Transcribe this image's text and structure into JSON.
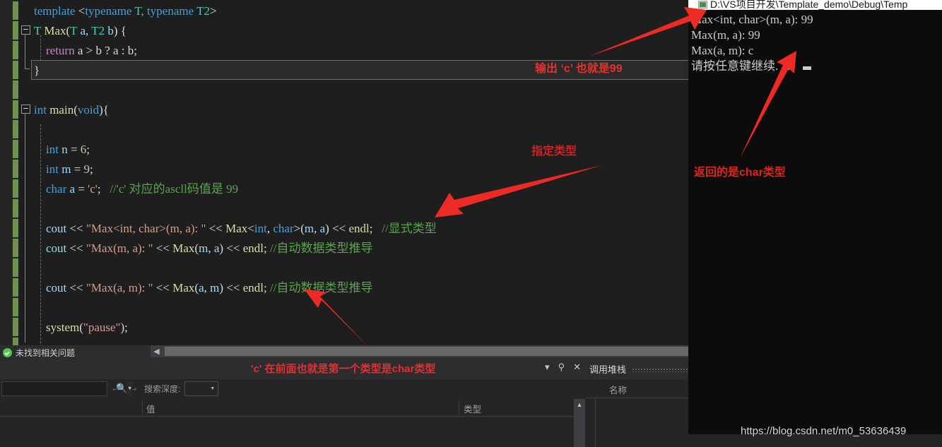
{
  "editor": {
    "lines": [
      {
        "indent": 0,
        "tokens": [
          {
            "t": "template ",
            "c": "k"
          },
          {
            "t": "<",
            "c": "op"
          },
          {
            "t": "typename",
            "c": "k"
          },
          {
            "t": " T, ",
            "c": "type"
          },
          {
            "t": "typename",
            "c": "k"
          },
          {
            "t": " T2",
            "c": "type"
          },
          {
            "t": ">",
            "c": "op"
          }
        ]
      },
      {
        "indent": 0,
        "tokens": [
          {
            "t": "T",
            "c": "type"
          },
          {
            "t": " ",
            "c": "op"
          },
          {
            "t": "Max",
            "c": "fn"
          },
          {
            "t": "(",
            "c": "pn"
          },
          {
            "t": "T",
            "c": "type"
          },
          {
            "t": " a, ",
            "c": "id"
          },
          {
            "t": "T2",
            "c": "type"
          },
          {
            "t": " b",
            "c": "id"
          },
          {
            "t": ") {",
            "c": "pn"
          }
        ]
      },
      {
        "indent": 0,
        "tokens": [
          {
            "t": "    ",
            "c": "op"
          },
          {
            "t": "return",
            "c": "pl"
          },
          {
            "t": " a > b ? a : b;",
            "c": "op"
          }
        ]
      },
      {
        "indent": 0,
        "tokens": [
          {
            "t": "}",
            "c": "pn"
          }
        ]
      },
      {
        "indent": 0,
        "tokens": []
      },
      {
        "indent": 0,
        "tokens": [
          {
            "t": "int",
            "c": "k"
          },
          {
            "t": " ",
            "c": "op"
          },
          {
            "t": "main",
            "c": "fn"
          },
          {
            "t": "(",
            "c": "pn"
          },
          {
            "t": "void",
            "c": "k"
          },
          {
            "t": "){",
            "c": "pn"
          }
        ]
      },
      {
        "indent": 0,
        "tokens": []
      },
      {
        "indent": 0,
        "tokens": [
          {
            "t": "    ",
            "c": "op"
          },
          {
            "t": "int",
            "c": "k"
          },
          {
            "t": " ",
            "c": "op"
          },
          {
            "t": "n",
            "c": "id"
          },
          {
            "t": " = ",
            "c": "op"
          },
          {
            "t": "6",
            "c": "num"
          },
          {
            "t": ";",
            "c": "pn"
          }
        ]
      },
      {
        "indent": 0,
        "tokens": [
          {
            "t": "    ",
            "c": "op"
          },
          {
            "t": "int",
            "c": "k"
          },
          {
            "t": " ",
            "c": "op"
          },
          {
            "t": "m",
            "c": "id"
          },
          {
            "t": " = ",
            "c": "op"
          },
          {
            "t": "9",
            "c": "num"
          },
          {
            "t": ";",
            "c": "pn"
          }
        ]
      },
      {
        "indent": 0,
        "tokens": [
          {
            "t": "    ",
            "c": "op"
          },
          {
            "t": "char",
            "c": "k"
          },
          {
            "t": " ",
            "c": "op"
          },
          {
            "t": "a",
            "c": "id"
          },
          {
            "t": " = ",
            "c": "op"
          },
          {
            "t": "'c'",
            "c": "str"
          },
          {
            "t": ";",
            "c": "pn"
          },
          {
            "t": "   //'c' 对应的ascll码值是 99",
            "c": "cm"
          }
        ]
      },
      {
        "indent": 0,
        "tokens": []
      },
      {
        "indent": 0,
        "tokens": [
          {
            "t": "    ",
            "c": "op"
          },
          {
            "t": "cout",
            "c": "id"
          },
          {
            "t": " << ",
            "c": "op"
          },
          {
            "t": "\"Max<int, char>(m, a): \"",
            "c": "str"
          },
          {
            "t": " << ",
            "c": "op"
          },
          {
            "t": "Max",
            "c": "fn"
          },
          {
            "t": "<",
            "c": "op"
          },
          {
            "t": "int",
            "c": "k"
          },
          {
            "t": ", ",
            "c": "pn"
          },
          {
            "t": "char",
            "c": "k"
          },
          {
            "t": ">(",
            "c": "pn"
          },
          {
            "t": "m",
            "c": "id"
          },
          {
            "t": ", ",
            "c": "pn"
          },
          {
            "t": "a",
            "c": "id"
          },
          {
            "t": ")",
            "c": "pn"
          },
          {
            "t": " << ",
            "c": "op"
          },
          {
            "t": "endl",
            "c": "fn"
          },
          {
            "t": ";",
            "c": "pn"
          },
          {
            "t": "   //显式类型",
            "c": "cm"
          }
        ]
      },
      {
        "indent": 0,
        "tokens": [
          {
            "t": "    ",
            "c": "op"
          },
          {
            "t": "cout",
            "c": "id"
          },
          {
            "t": " << ",
            "c": "op"
          },
          {
            "t": "\"Max(m, a): \"",
            "c": "str"
          },
          {
            "t": " << ",
            "c": "op"
          },
          {
            "t": "Max",
            "c": "fn"
          },
          {
            "t": "(",
            "c": "pn"
          },
          {
            "t": "m",
            "c": "id"
          },
          {
            "t": ", ",
            "c": "pn"
          },
          {
            "t": "a",
            "c": "id"
          },
          {
            "t": ")",
            "c": "pn"
          },
          {
            "t": " << ",
            "c": "op"
          },
          {
            "t": "endl",
            "c": "fn"
          },
          {
            "t": "; ",
            "c": "pn"
          },
          {
            "t": "//自动数据类型推导",
            "c": "cm"
          }
        ]
      },
      {
        "indent": 0,
        "tokens": []
      },
      {
        "indent": 0,
        "tokens": [
          {
            "t": "    ",
            "c": "op"
          },
          {
            "t": "cout",
            "c": "id"
          },
          {
            "t": " << ",
            "c": "op"
          },
          {
            "t": "\"Max(a, m): \"",
            "c": "str"
          },
          {
            "t": " << ",
            "c": "op"
          },
          {
            "t": "Max",
            "c": "fn"
          },
          {
            "t": "(",
            "c": "pn"
          },
          {
            "t": "a",
            "c": "id"
          },
          {
            "t": ", ",
            "c": "pn"
          },
          {
            "t": "m",
            "c": "id"
          },
          {
            "t": ")",
            "c": "pn"
          },
          {
            "t": " << ",
            "c": "op"
          },
          {
            "t": "endl",
            "c": "fn"
          },
          {
            "t": "; ",
            "c": "pn"
          },
          {
            "t": "//自动数据类型推导",
            "c": "cm"
          }
        ]
      },
      {
        "indent": 0,
        "tokens": []
      },
      {
        "indent": 0,
        "tokens": [
          {
            "t": "    ",
            "c": "op"
          },
          {
            "t": "system",
            "c": "fn"
          },
          {
            "t": "(",
            "c": "pn"
          },
          {
            "t": "\"pause\"",
            "c": "str"
          },
          {
            "t": ")",
            "c": "pn"
          },
          {
            "t": ";",
            "c": "pn"
          }
        ]
      }
    ]
  },
  "status": {
    "message": "未找到相关问题",
    "icon": "check-circle-icon"
  },
  "locals_panel": {
    "search_value": "",
    "search_placeholder": "",
    "depth_label": "搜索深度:",
    "depth_value": "",
    "columns": [
      "值",
      "类型"
    ],
    "rows": []
  },
  "callstack_panel": {
    "title": "调用堆栈",
    "columns": [
      "名称"
    ],
    "rows": []
  },
  "panel_header_icons": [
    "chevron-down-icon",
    "pin-icon",
    "close-icon"
  ],
  "console": {
    "title": "D:\\VS项目开发\\Template_demo\\Debug\\Temp",
    "lines": [
      "Max<int, char>(m, a): 99",
      "Max(m, a): 99",
      "Max(a, m): c",
      "请按任意键继续. . ."
    ]
  },
  "annotations": [
    {
      "id": "anno-output",
      "text": "输出 ‘c’ 也就是99"
    },
    {
      "id": "anno-specify-type",
      "text": "指定类型"
    },
    {
      "id": "anno-return-char",
      "text": "返回的是char类型"
    },
    {
      "id": "anno-first-type",
      "text": "'c' 在前面也就是第一个类型是char类型"
    }
  ],
  "watermark": "https://blog.csdn.net/m0_53636439",
  "colors": {
    "editor_bg": "#1e1e1e",
    "annotation_red": "#e02424",
    "comment_green": "#57a64a",
    "string_orange": "#d69d85",
    "keyword_blue": "#4a9fd8",
    "type_teal": "#4ec9b0",
    "function_yellow": "#dcdcaa",
    "identifier_blue": "#9cdcfe",
    "change_bar_green": "#6d9250"
  }
}
